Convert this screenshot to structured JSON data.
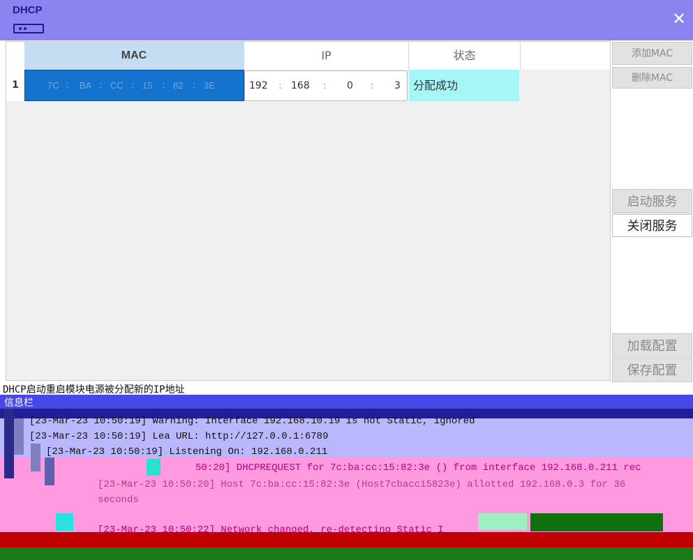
{
  "window": {
    "title": "DHCP",
    "close_label": "✕"
  },
  "table": {
    "headers": {
      "mac": "MAC",
      "ip": "IP",
      "status": "状态"
    },
    "rows": [
      {
        "index": "1",
        "mac": [
          "7C",
          "BA",
          "CC",
          "15",
          "82",
          "3E"
        ],
        "ip": [
          "192",
          "168",
          "0",
          "3"
        ],
        "status": "分配成功"
      }
    ]
  },
  "sidebar": {
    "add_mac": "添加MAC",
    "delete_mac": "删除MAC",
    "start_service": "启动服务",
    "stop_service": "关闭服务",
    "load_config": "加载配置",
    "save_config": "保存配置"
  },
  "status_bar": {
    "text": "DHCP启动重启模块电源被分配新的IP地址"
  },
  "log": {
    "title": "信息栏",
    "lines": [
      "[23-Mar-23 10:50:19] Warning: Interface 192.168.10.19 is not Static, ignored",
      "[23-Mar-23 10:50:19] Lea  URL: http://127.0.0.1:6789",
      "[23-Mar-23 10:50:19] Listening On: 192.168.0.211",
      "50:20] DHCPREQUEST for 7c:ba:cc:15:82:3e () from interface 192.168.0.211 rec",
      "[23-Mar-23 10:50:20] Host 7c:ba:cc:15:82:3e (Host7cbacc15823e) allotted 192.168.0.3 for 36",
      "seconds",
      "[23-Mar-23 10:50:22] Network changed, re-detecting Static I"
    ]
  },
  "colors": {
    "titlebar": "#8b83f0",
    "mac_selected": "#1573d0",
    "status_ok": "#a6f5f7"
  }
}
